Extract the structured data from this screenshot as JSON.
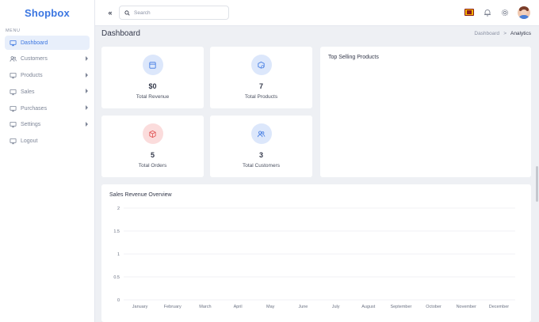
{
  "app": {
    "brand": "Shopbox"
  },
  "sidebar": {
    "menu_title": "MENU",
    "items": [
      {
        "label": "Dashboard",
        "icon": "monitor-icon",
        "active": true,
        "has_submenu": false
      },
      {
        "label": "Customers",
        "icon": "users-icon",
        "active": false,
        "has_submenu": true
      },
      {
        "label": "Products",
        "icon": "monitor-icon",
        "active": false,
        "has_submenu": true
      },
      {
        "label": "Sales",
        "icon": "monitor-icon",
        "active": false,
        "has_submenu": true
      },
      {
        "label": "Purchases",
        "icon": "monitor-icon",
        "active": false,
        "has_submenu": true
      },
      {
        "label": "Settings",
        "icon": "monitor-icon",
        "active": false,
        "has_submenu": true
      },
      {
        "label": "Logout",
        "icon": "monitor-icon",
        "active": false,
        "has_submenu": false
      }
    ]
  },
  "topbar": {
    "collapse_label": "«",
    "search_placeholder": "Search"
  },
  "page": {
    "title": "Dashboard",
    "breadcrumb": [
      "Dashboard",
      "Analytics"
    ]
  },
  "stats": [
    {
      "value": "$0",
      "label": "Total Revenue",
      "icon": "calendar-icon",
      "tint": "#dce7fb",
      "stroke": "#3b76e1"
    },
    {
      "value": "7",
      "label": "Total Products",
      "icon": "box-search-icon",
      "tint": "#dce7fb",
      "stroke": "#3b76e1"
    },
    {
      "value": "5",
      "label": "Total Orders",
      "icon": "cube-icon",
      "tint": "#fbdcdc",
      "stroke": "#e05555"
    },
    {
      "value": "3",
      "label": "Total Customers",
      "icon": "users-icon",
      "tint": "#dce7fb",
      "stroke": "#3b76e1"
    }
  ],
  "top_selling": {
    "title": "Top Selling Products"
  },
  "colors": {
    "accent": "#3b76e1",
    "danger": "#e05555"
  },
  "chart_data": {
    "type": "line",
    "title": "Sales Revenue Overview",
    "categories": [
      "January",
      "February",
      "March",
      "April",
      "May",
      "June",
      "July",
      "August",
      "September",
      "October",
      "November",
      "December"
    ],
    "series": [],
    "ylim": [
      0,
      2
    ],
    "yticks": [
      "2",
      "1.5",
      "1",
      "0.5",
      "0"
    ],
    "grid": true
  }
}
